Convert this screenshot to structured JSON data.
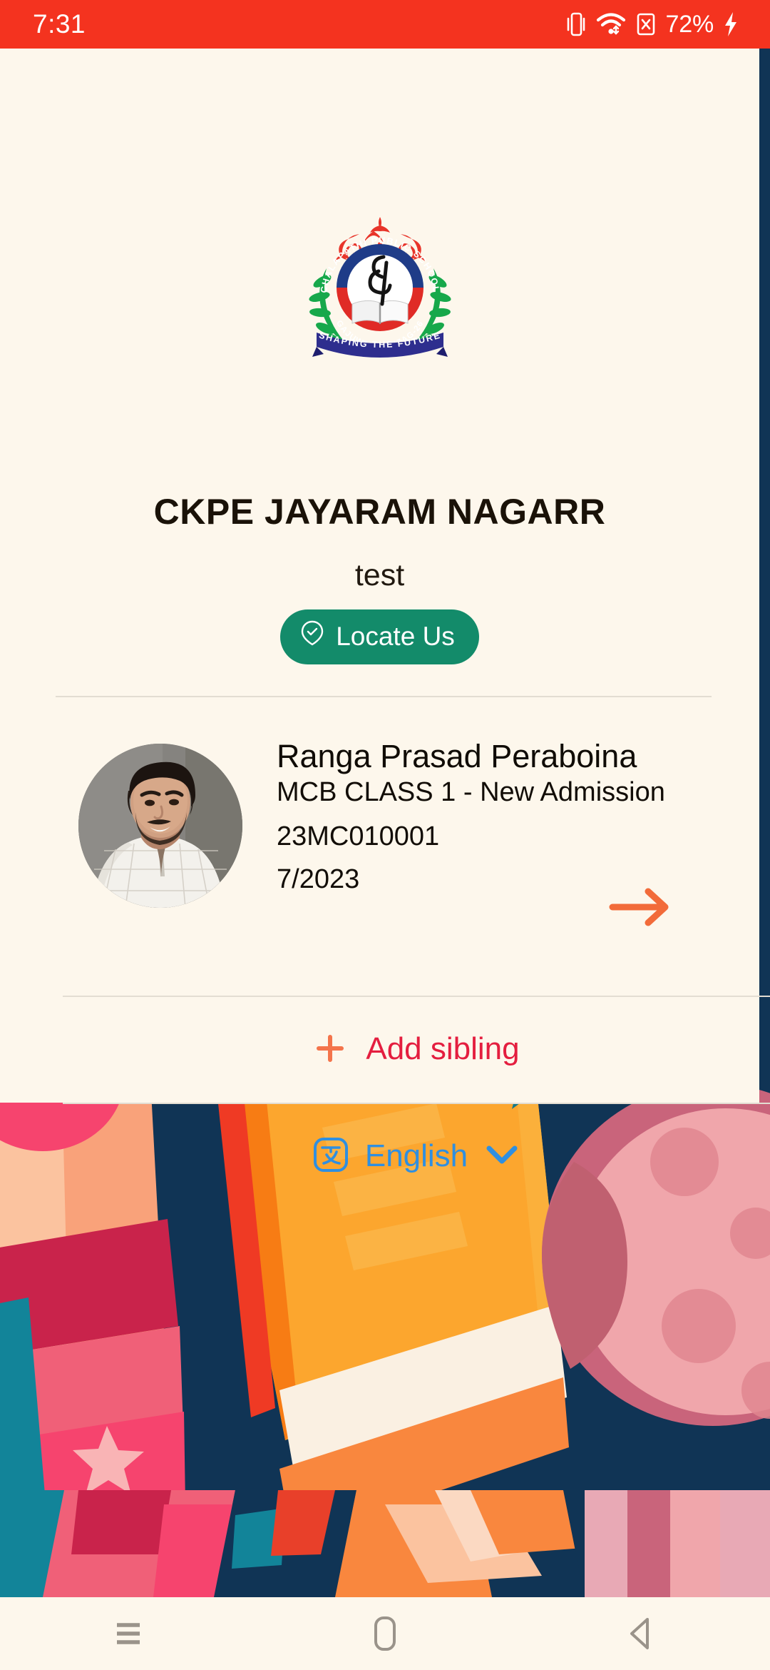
{
  "status_bar": {
    "time": "7:31",
    "battery_percent": "72%",
    "icons": [
      "vibrate-icon",
      "wifi-icon",
      "sim-card-off-icon",
      "charging-bolt-icon"
    ],
    "background_color": "#F4331F"
  },
  "school": {
    "logo": {
      "icon": "school-crest-logo",
      "arc_top_text": "CHALAPATHI PUBLIC SCHOOL",
      "arc_bottom_text": "GAJUWAKA, VIZAG-26",
      "banner_text": "SHAPING THE FUTURE"
    },
    "name": "CKPE JAYARAM NAGARR",
    "subtitle": "test",
    "locate_button": {
      "label": "Locate Us",
      "icon": "location-check-icon",
      "color": "#138B6A"
    }
  },
  "student": {
    "avatar": "student-photo",
    "name": "Ranga Prasad Peraboina",
    "class": "MCB CLASS 1 - New Admission",
    "admission_number": "23MC010001",
    "date": "7/2023",
    "go_arrow_icon": "arrow-right-icon",
    "arrow_color": "#F26B3A"
  },
  "add_sibling": {
    "label": "Add sibling",
    "icon": "plus-icon",
    "label_color": "#E41E3F",
    "icon_color": "#F4744B"
  },
  "language": {
    "label": "English",
    "icon": "translate-icon",
    "chevron_icon": "chevron-down-icon",
    "color": "#2F8FE0"
  },
  "nav_bar": {
    "recents_icon": "recents-menu-icon",
    "home_icon": "home-icon",
    "back_icon": "back-triangle-icon",
    "icon_color": "#9A938A"
  },
  "background": {
    "illustration": "school-supplies-illustration",
    "base_color": "#103455"
  }
}
